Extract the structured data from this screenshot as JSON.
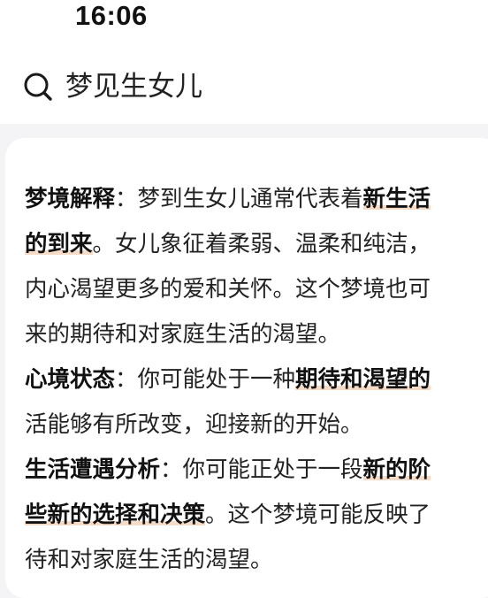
{
  "status_bar": {
    "time": "16:06"
  },
  "search": {
    "icon": "search-icon",
    "query": "梦见生女儿"
  },
  "answer": {
    "lines": [
      [
        {
          "text": "梦境解释",
          "style": "b"
        },
        {
          "text": "：梦到生女儿通常代表着",
          "style": "n"
        },
        {
          "text": "新生活",
          "style": "hl"
        }
      ],
      [
        {
          "text": "的到来",
          "style": "hl"
        },
        {
          "text": "。女儿象征着柔弱、温柔和纯洁，",
          "style": "n"
        }
      ],
      [
        {
          "text": "内心渴望更多的爱和关怀。这个梦境也可",
          "style": "n"
        }
      ],
      [
        {
          "text": "来的期待和对家庭生活的渴望。",
          "style": "n"
        }
      ],
      [
        {
          "text": "心境状态",
          "style": "b"
        },
        {
          "text": "：你可能处于一种",
          "style": "n"
        },
        {
          "text": "期待和渴望的",
          "style": "hl"
        }
      ],
      [
        {
          "text": "活能够有所改变，迎接新的开始。",
          "style": "n"
        }
      ],
      [
        {
          "text": "生活遭遇分析",
          "style": "b"
        },
        {
          "text": "：你可能正处于一段",
          "style": "n"
        },
        {
          "text": "新的阶",
          "style": "hl"
        }
      ],
      [
        {
          "text": "些新的选择和决策",
          "style": "hl"
        },
        {
          "text": "。这个梦境可能反映了",
          "style": "n"
        }
      ],
      [
        {
          "text": "待和对家庭生活的渴望。",
          "style": "n"
        }
      ]
    ]
  }
}
